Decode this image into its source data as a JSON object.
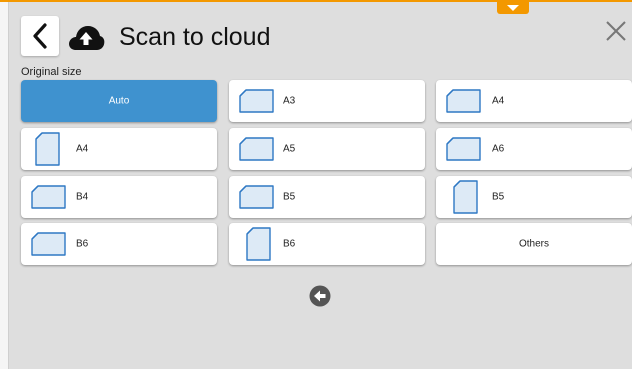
{
  "header": {
    "title": "Scan to cloud"
  },
  "original_size": {
    "label": "Original size",
    "options": [
      {
        "label": "Auto",
        "selected": true,
        "icon": "none"
      },
      {
        "label": "A3",
        "icon": "landscape-page-icon"
      },
      {
        "label": "A4",
        "icon": "landscape-page-icon"
      },
      {
        "label": "A4",
        "icon": "portrait-page-icon"
      },
      {
        "label": "A5",
        "icon": "landscape-page-icon"
      },
      {
        "label": "A6",
        "icon": "landscape-page-icon"
      },
      {
        "label": "B4",
        "icon": "landscape-page-icon"
      },
      {
        "label": "B5",
        "icon": "landscape-page-icon"
      },
      {
        "label": "B5",
        "icon": "portrait-page-icon"
      },
      {
        "label": "B6",
        "icon": "landscape-page-icon"
      },
      {
        "label": "B6",
        "icon": "portrait-page-icon"
      },
      {
        "label": "Others",
        "icon": "none"
      }
    ]
  },
  "colors": {
    "accent": "#f39800",
    "selected": "#3f92cf",
    "paper_fill": "#ddeaf6",
    "paper_stroke": "#2e78c4"
  }
}
